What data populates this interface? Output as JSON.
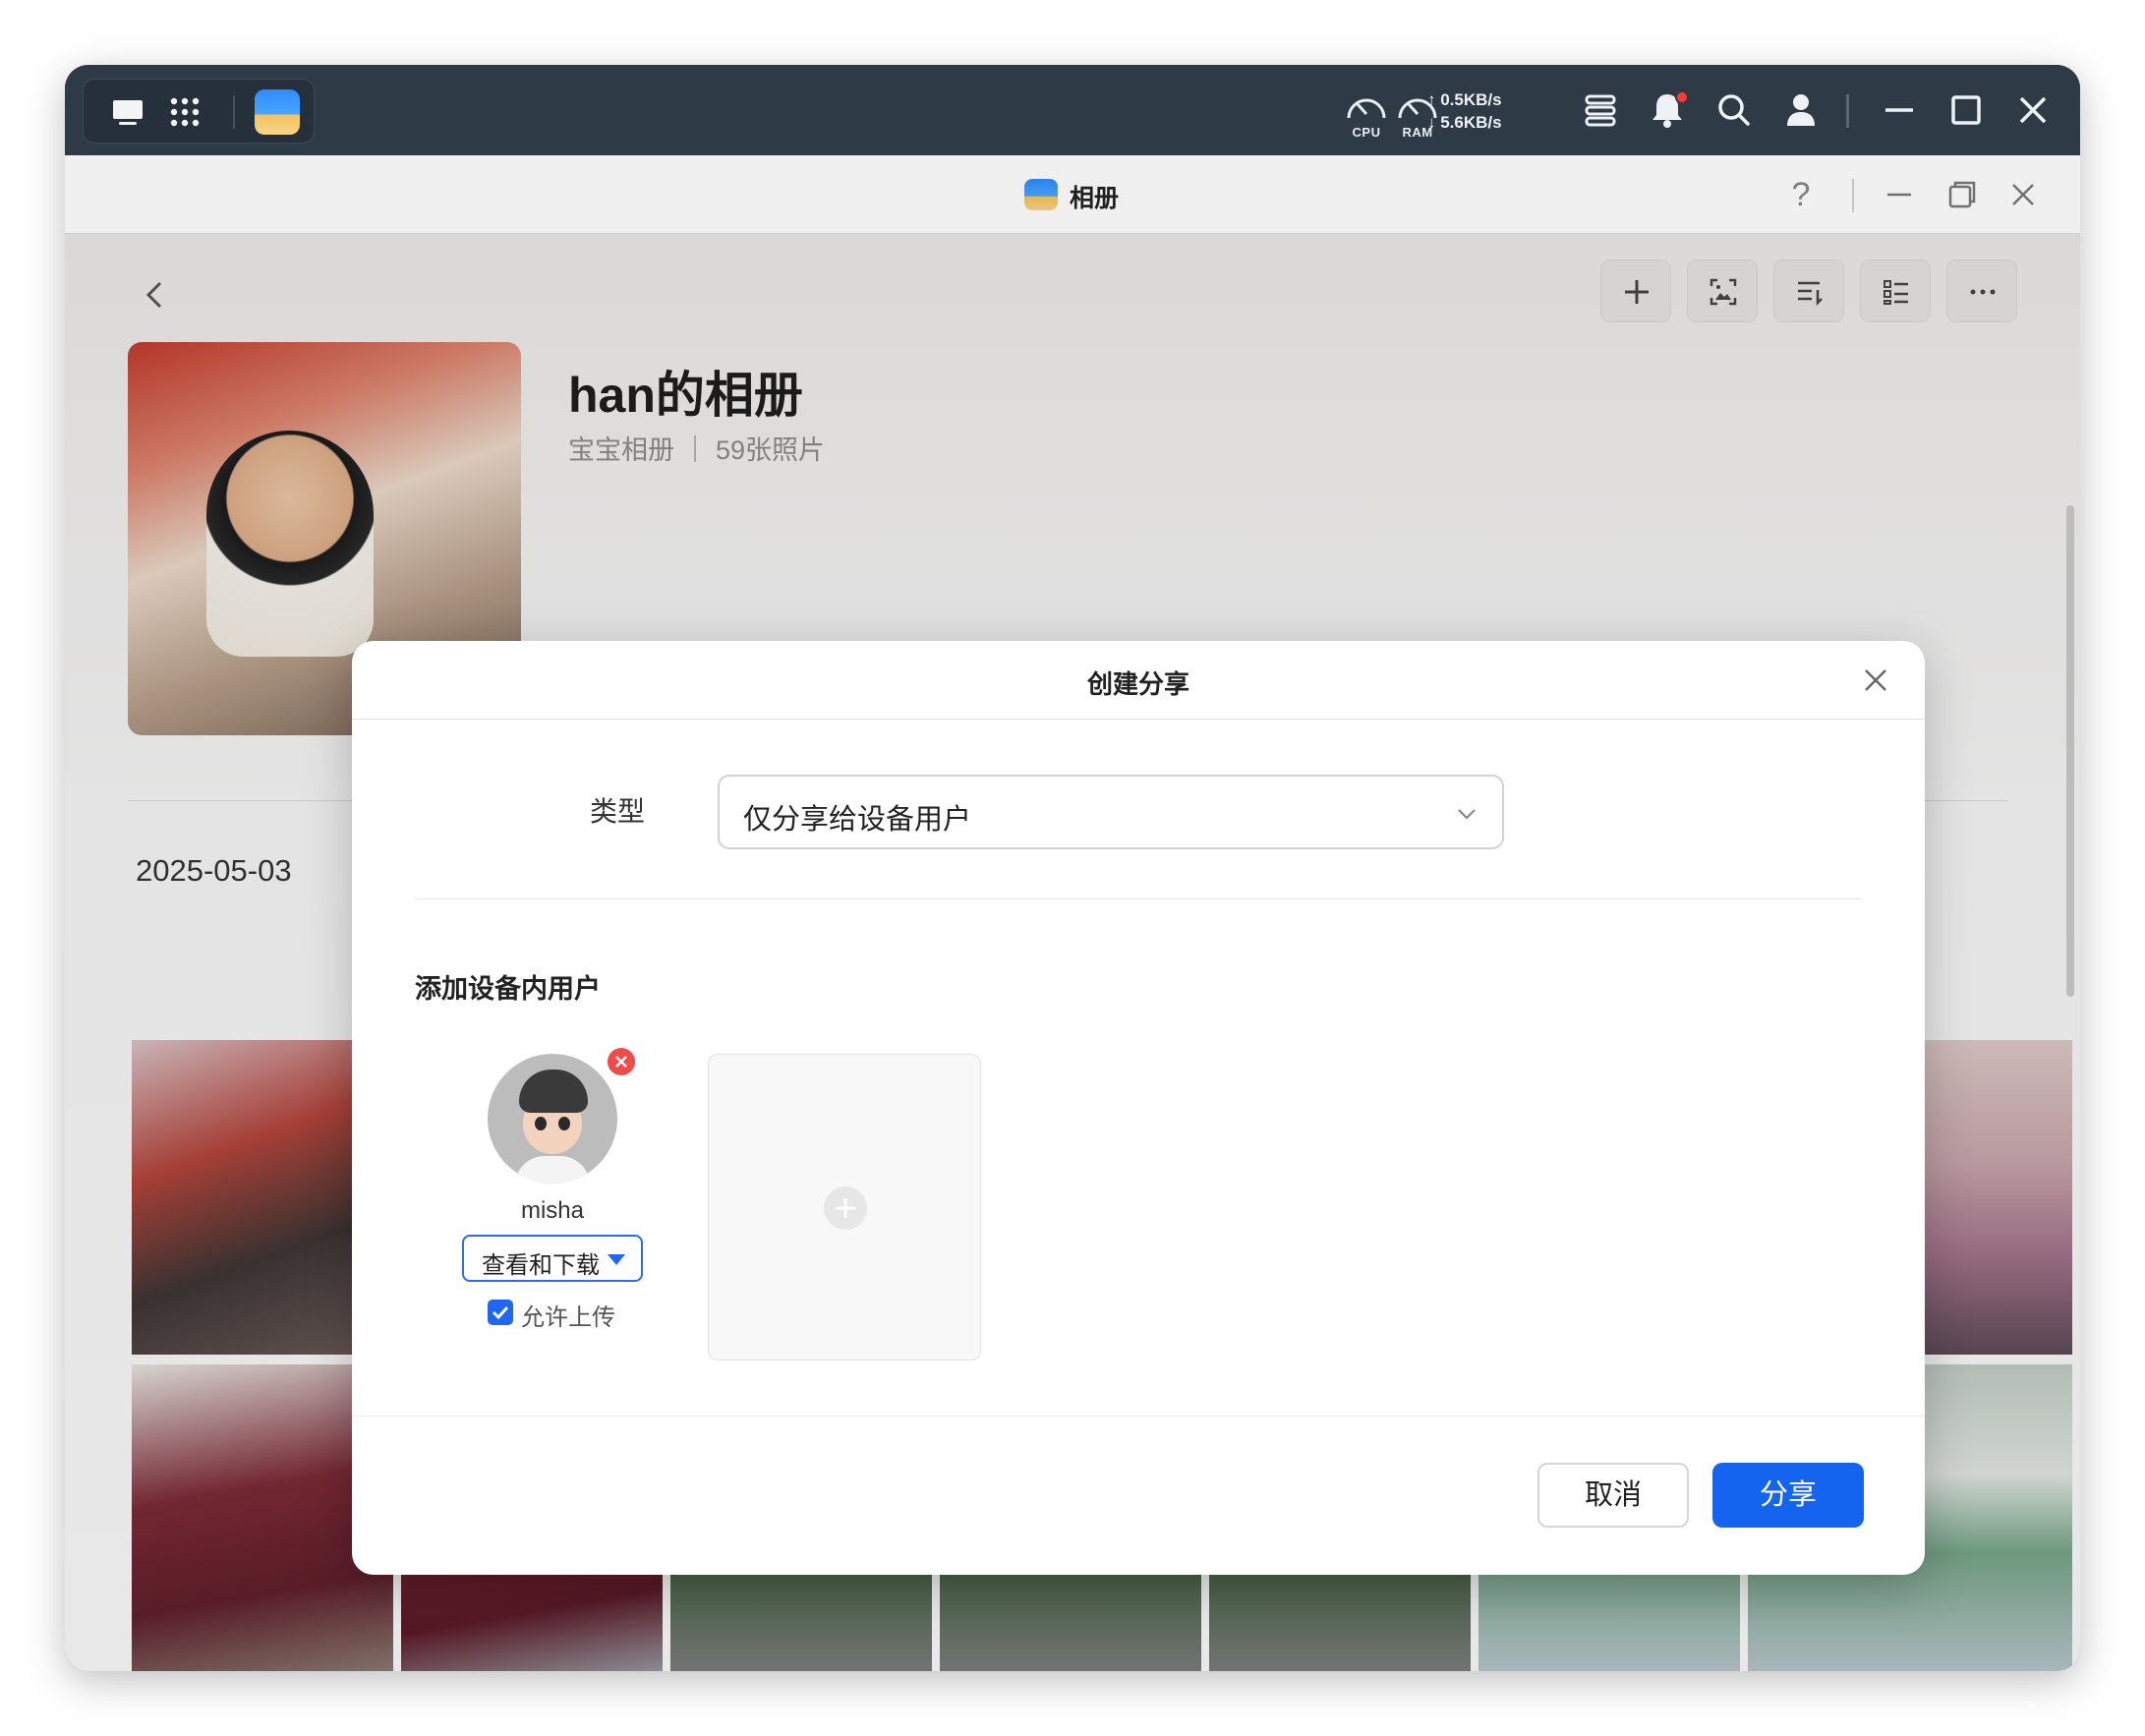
{
  "system_bar": {
    "cpu_label": "CPU",
    "ram_label": "RAM",
    "upload_speed": "↑ 0.5KB/s",
    "download_speed": "↓ 5.6KB/s"
  },
  "app": {
    "title": "相册",
    "help": "?"
  },
  "album": {
    "title": "han的相册",
    "subtitle": "宝宝相册 ｜ 59张照片",
    "date": "2025-05-03"
  },
  "dialog": {
    "title": "创建分享",
    "type_label": "类型",
    "type_value": "仅分享给设备用户",
    "section_title": "添加设备内用户",
    "user": {
      "name": "misha",
      "permission": "查看和下载",
      "allow_upload_label": "允许上传",
      "allow_upload": true
    },
    "cancel_label": "取消",
    "share_label": "分享"
  },
  "colors": {
    "accent": "#1464f0",
    "topbar": "#2e3a45",
    "remove_badge": "#f04a4a"
  }
}
